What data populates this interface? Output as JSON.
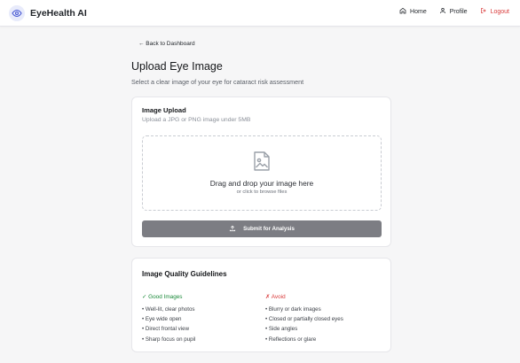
{
  "app": {
    "name": "EyeHealth AI"
  },
  "nav": {
    "home": "Home",
    "profile": "Profile",
    "logout": "Logout"
  },
  "back_link": "← Back to Dashboard",
  "page": {
    "title": "Upload Eye Image",
    "subtitle": "Select a clear image of your eye for cataract risk assessment"
  },
  "upload": {
    "title": "Image Upload",
    "subtitle": "Upload a JPG or PNG image under 5MB",
    "drop_main": "Drag and drop your image here",
    "drop_sub": "or click to browse files",
    "submit_label": "Submit for Analysis"
  },
  "guidelines": {
    "title": "Image Quality Guidelines",
    "good": {
      "heading": "✓ Good Images",
      "items": [
        "• Well-lit, clear photos",
        "• Eye wide open",
        "• Direct frontal view",
        "• Sharp focus on pupil"
      ]
    },
    "avoid": {
      "heading": "✗ Avoid",
      "items": [
        "• Blurry or dark images",
        "• Closed or partially closed eyes",
        "• Side angles",
        "• Reflections or glare"
      ]
    }
  },
  "colors": {
    "brand_accent": "#4a5bd4",
    "logout": "#d93b3b",
    "good": "#1b8a3a",
    "avoid": "#d93b3b",
    "submit_bg": "#7c7d83"
  },
  "icons": {
    "brand": "eye-icon",
    "home": "home-icon",
    "profile": "user-icon",
    "logout": "logout-icon",
    "dropzone": "image-file-icon",
    "submit": "upload-icon"
  }
}
